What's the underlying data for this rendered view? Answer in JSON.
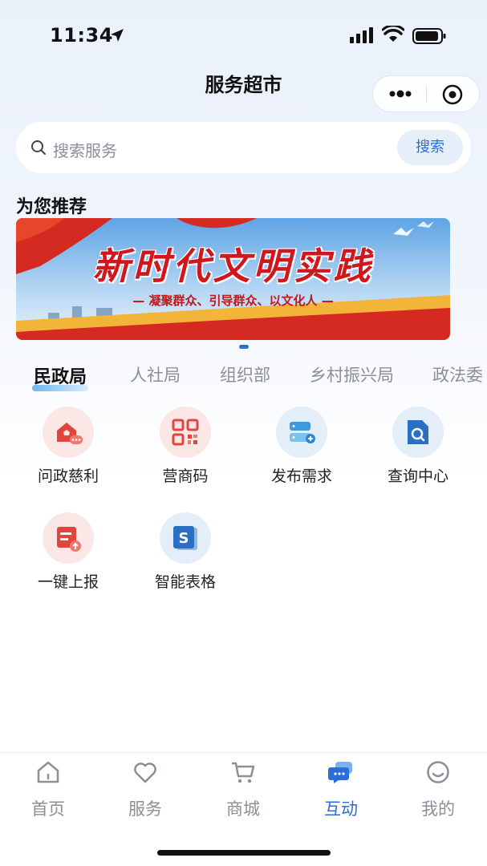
{
  "status": {
    "time": "11:34"
  },
  "nav": {
    "title": "服务超市"
  },
  "search": {
    "placeholder": "搜索服务",
    "button": "搜索"
  },
  "recommend": {
    "title": "为您推荐",
    "banner_title": "新时代文明实践",
    "banner_sub": "— 凝聚群众、引导群众、以文化人 —"
  },
  "tabs": [
    {
      "label": "民政局",
      "active": true
    },
    {
      "label": "人社局",
      "active": false
    },
    {
      "label": "组织部",
      "active": false
    },
    {
      "label": "乡村振兴局",
      "active": false
    },
    {
      "label": "政法委",
      "active": false
    }
  ],
  "services": [
    {
      "label": "问政慈利",
      "icon": "house-chat-icon"
    },
    {
      "label": "营商码",
      "icon": "qr-code-icon"
    },
    {
      "label": "发布需求",
      "icon": "server-add-icon"
    },
    {
      "label": "查询中心",
      "icon": "doc-search-icon"
    },
    {
      "label": "一键上报",
      "icon": "report-upload-icon"
    },
    {
      "label": "智能表格",
      "icon": "sheet-s-icon"
    }
  ],
  "tabbar": [
    {
      "label": "首页",
      "icon": "home-icon",
      "active": false
    },
    {
      "label": "服务",
      "icon": "heart-icon",
      "active": false
    },
    {
      "label": "商城",
      "icon": "cart-icon",
      "active": false
    },
    {
      "label": "互动",
      "icon": "chat-icon",
      "active": true
    },
    {
      "label": "我的",
      "icon": "profile-icon",
      "active": false
    }
  ],
  "colors": {
    "accent": "#2a6ed8",
    "banner_red": "#d0171d"
  }
}
